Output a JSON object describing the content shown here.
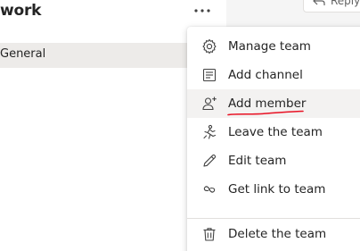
{
  "team": {
    "title": "work",
    "channel": "General"
  },
  "header": {
    "reply_label": "Reply"
  },
  "menu": {
    "items": [
      {
        "label": "Manage team",
        "icon": "gear-icon"
      },
      {
        "label": "Add channel",
        "icon": "add-channel-icon"
      },
      {
        "label": "Add member",
        "icon": "add-member-icon",
        "highlighted": true
      },
      {
        "label": "Leave the team",
        "icon": "leave-team-icon"
      },
      {
        "label": "Edit team",
        "icon": "pencil-icon"
      },
      {
        "label": "Get link to team",
        "icon": "link-icon"
      },
      {
        "label": "Delete the team",
        "icon": "trash-icon"
      }
    ]
  },
  "colors": {
    "annotation": "#e81123",
    "text": "#242424",
    "selected_row": "#edebe9"
  }
}
